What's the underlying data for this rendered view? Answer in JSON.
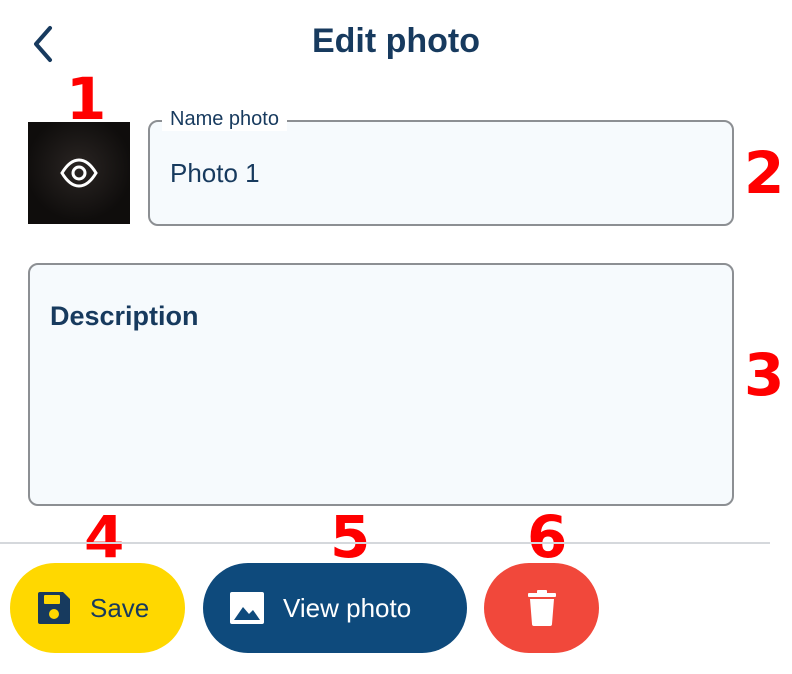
{
  "header": {
    "title": "Edit photo",
    "back_icon": "chevron-left-icon"
  },
  "callouts": [
    "1",
    "2",
    "3",
    "4",
    "5",
    "6"
  ],
  "thumbnail": {
    "icon": "eye-icon"
  },
  "name_field": {
    "label": "Name photo",
    "value": "Photo 1"
  },
  "description_field": {
    "placeholder": "Description",
    "value": ""
  },
  "actions": {
    "save_label": "Save",
    "save_icon": "floppy-disk-icon",
    "view_label": "View photo",
    "view_icon": "image-icon",
    "delete_icon": "trash-icon"
  },
  "colors": {
    "primary": "#173a5e",
    "save": "#ffd800",
    "view": "#0e4a7c",
    "delete": "#f1483b",
    "callout": "#ff0000"
  }
}
